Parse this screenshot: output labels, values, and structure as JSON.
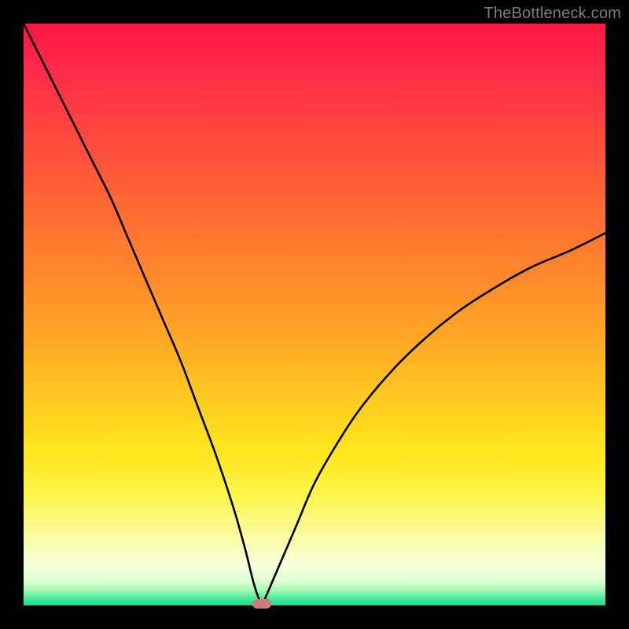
{
  "watermark": {
    "text": "TheBottleneck.com"
  },
  "colors": {
    "frame_bg": "#000000",
    "watermark": "#7d7d7d",
    "curve": "#000000",
    "pill": "#cf7b77",
    "gradient_top": "#ff1744",
    "gradient_bottom": "#17e391"
  },
  "chart_data": {
    "type": "line",
    "title": "",
    "xlabel": "",
    "ylabel": "",
    "xlim": [
      0,
      100
    ],
    "ylim": [
      0,
      100
    ],
    "grid": false,
    "legend": false,
    "series": [
      {
        "name": "bottleneck-curve",
        "x": [
          0,
          3,
          6,
          9,
          12,
          15,
          18,
          21,
          24,
          27,
          30,
          33,
          36,
          38,
          39.5,
          40.5,
          41,
          41.5,
          42.5,
          44,
          47,
          50,
          54,
          58,
          63,
          68,
          74,
          80,
          87,
          94,
          100
        ],
        "y": [
          100,
          94,
          88,
          82,
          76,
          70,
          63,
          56,
          49,
          42,
          34,
          26,
          17,
          10,
          4,
          1,
          0.3,
          1.2,
          3.5,
          7,
          14,
          21,
          28,
          34,
          40,
          45,
          50,
          54,
          58,
          61,
          64
        ]
      }
    ],
    "annotations": [
      {
        "name": "minimum-marker",
        "x": 41,
        "y": 0.3,
        "shape": "pill",
        "color": "#cf7b77"
      }
    ]
  }
}
